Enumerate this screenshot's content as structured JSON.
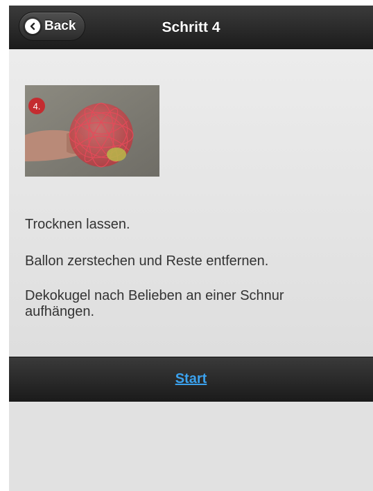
{
  "header": {
    "back_label": "Back",
    "back_icon": "chevron-left-icon",
    "title": "Schritt 4"
  },
  "main": {
    "image_step_number": "4.",
    "paragraphs": [
      "Trocknen lassen.",
      "Ballon zerstechen und Reste entfernen.",
      "Dekokugel nach Belieben an einer Schnur aufhängen."
    ]
  },
  "footer": {
    "start_label": "Start"
  },
  "colors": {
    "header_bg": "#2a2a2a",
    "content_bg": "#e6e6e6",
    "link": "#3ba2ee",
    "text": "#333333"
  }
}
